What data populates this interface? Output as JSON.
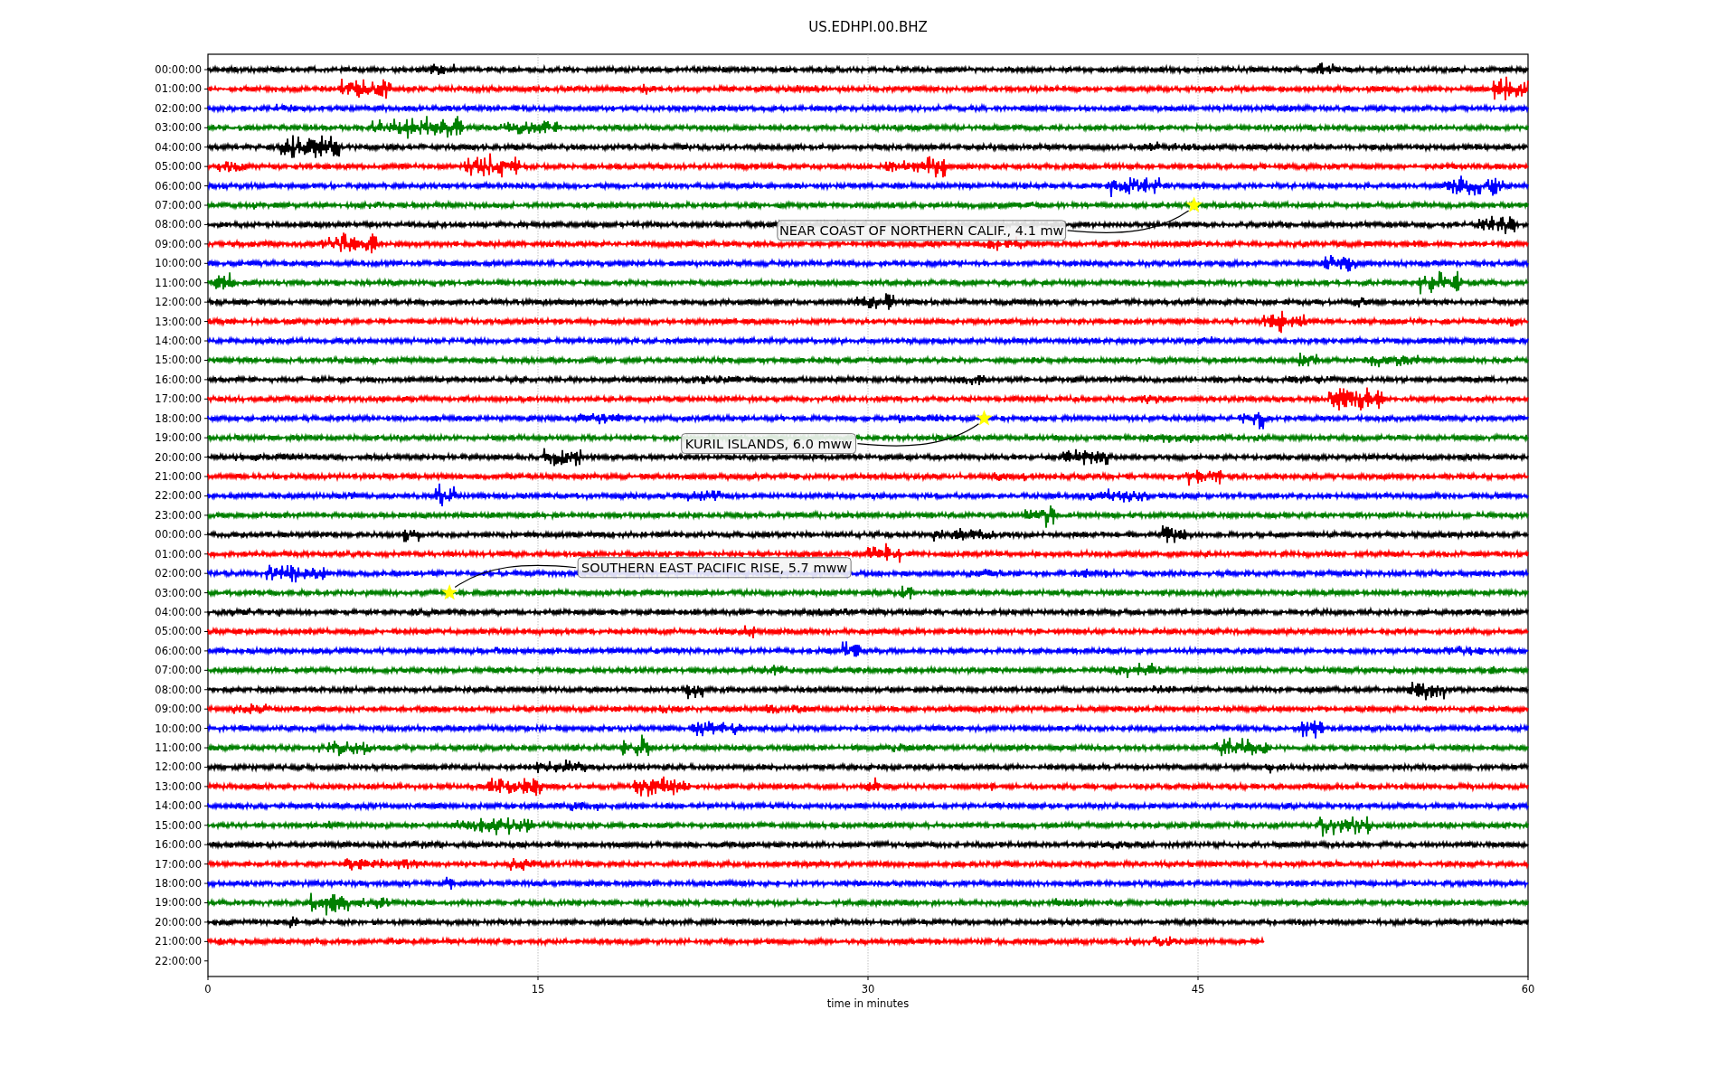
{
  "title": "US.EDHPI.00.BHZ",
  "chart": {
    "xlabel": "time in minutes",
    "xticks": [
      "0",
      "15",
      "30",
      "45",
      "60"
    ],
    "row_labels": [
      "00:00:00",
      "01:00:00",
      "02:00:00",
      "03:00:00",
      "04:00:00",
      "05:00:00",
      "06:00:00",
      "07:00:00",
      "08:00:00",
      "09:00:00",
      "10:00:00",
      "11:00:00",
      "12:00:00",
      "13:00:00",
      "14:00:00",
      "15:00:00",
      "16:00:00",
      "17:00:00",
      "18:00:00",
      "19:00:00",
      "20:00:00",
      "21:00:00",
      "22:00:00",
      "23:00:00",
      "00:00:00",
      "01:00:00",
      "02:00:00",
      "03:00:00",
      "04:00:00",
      "05:00:00",
      "06:00:00",
      "07:00:00",
      "08:00:00",
      "09:00:00",
      "10:00:00",
      "11:00:00",
      "12:00:00",
      "13:00:00",
      "14:00:00",
      "15:00:00",
      "16:00:00",
      "17:00:00",
      "18:00:00",
      "19:00:00",
      "20:00:00",
      "21:00:00",
      "22:00:00"
    ],
    "traces": [
      {
        "color": "#000000",
        "level": 1
      },
      {
        "color": "#ff0000",
        "level": 1
      },
      {
        "color": "#0000ff",
        "level": 1
      },
      {
        "color": "#008000",
        "level": 1
      },
      {
        "color": "#000000",
        "level": 1
      },
      {
        "color": "#ff0000",
        "level": 1
      },
      {
        "color": "#0000ff",
        "level": 1
      },
      {
        "color": "#008000",
        "level": 1,
        "event": {
          "label": "NEAR COAST OF NORTHERN CALIF., 4.1 mw",
          "level": 0.747
        }
      },
      {
        "color": "#000000",
        "level": 1
      },
      {
        "color": "#ff0000",
        "level": 1
      },
      {
        "color": "#0000ff",
        "level": 1
      },
      {
        "color": "#008000",
        "level": 1
      },
      {
        "color": "#000000",
        "level": 1
      },
      {
        "color": "#ff0000",
        "level": 1
      },
      {
        "color": "#0000ff",
        "level": 1
      },
      {
        "color": "#008000",
        "level": 1
      },
      {
        "color": "#000000",
        "level": 1
      },
      {
        "color": "#ff0000",
        "level": 1
      },
      {
        "color": "#0000ff",
        "level": 1,
        "event": {
          "label": "KURIL ISLANDS, 6.0 mww",
          "level": 0.588
        }
      },
      {
        "color": "#008000",
        "level": 1
      },
      {
        "color": "#000000",
        "level": 1
      },
      {
        "color": "#ff0000",
        "level": 1
      },
      {
        "color": "#0000ff",
        "level": 1
      },
      {
        "color": "#008000",
        "level": 1
      },
      {
        "color": "#000000",
        "level": 1
      },
      {
        "color": "#ff0000",
        "level": 1
      },
      {
        "color": "#0000ff",
        "level": 1
      },
      {
        "color": "#008000",
        "level": 1,
        "event": {
          "label": "SOUTHERN EAST PACIFIC RISE, 5.7 mww",
          "level": 0.183
        }
      },
      {
        "color": "#000000",
        "level": 1
      },
      {
        "color": "#ff0000",
        "level": 1
      },
      {
        "color": "#0000ff",
        "level": 1
      },
      {
        "color": "#008000",
        "level": 1
      },
      {
        "color": "#000000",
        "level": 1
      },
      {
        "color": "#ff0000",
        "level": 1
      },
      {
        "color": "#0000ff",
        "level": 1
      },
      {
        "color": "#008000",
        "level": 1
      },
      {
        "color": "#000000",
        "level": 1
      },
      {
        "color": "#ff0000",
        "level": 1
      },
      {
        "color": "#0000ff",
        "level": 1
      },
      {
        "color": "#008000",
        "level": 1
      },
      {
        "color": "#000000",
        "level": 1
      },
      {
        "color": "#ff0000",
        "level": 1
      },
      {
        "color": "#0000ff",
        "level": 1
      },
      {
        "color": "#008000",
        "level": 1
      },
      {
        "color": "#000000",
        "level": 1
      },
      {
        "color": "#ff0000",
        "level": 0.8
      }
    ]
  }
}
